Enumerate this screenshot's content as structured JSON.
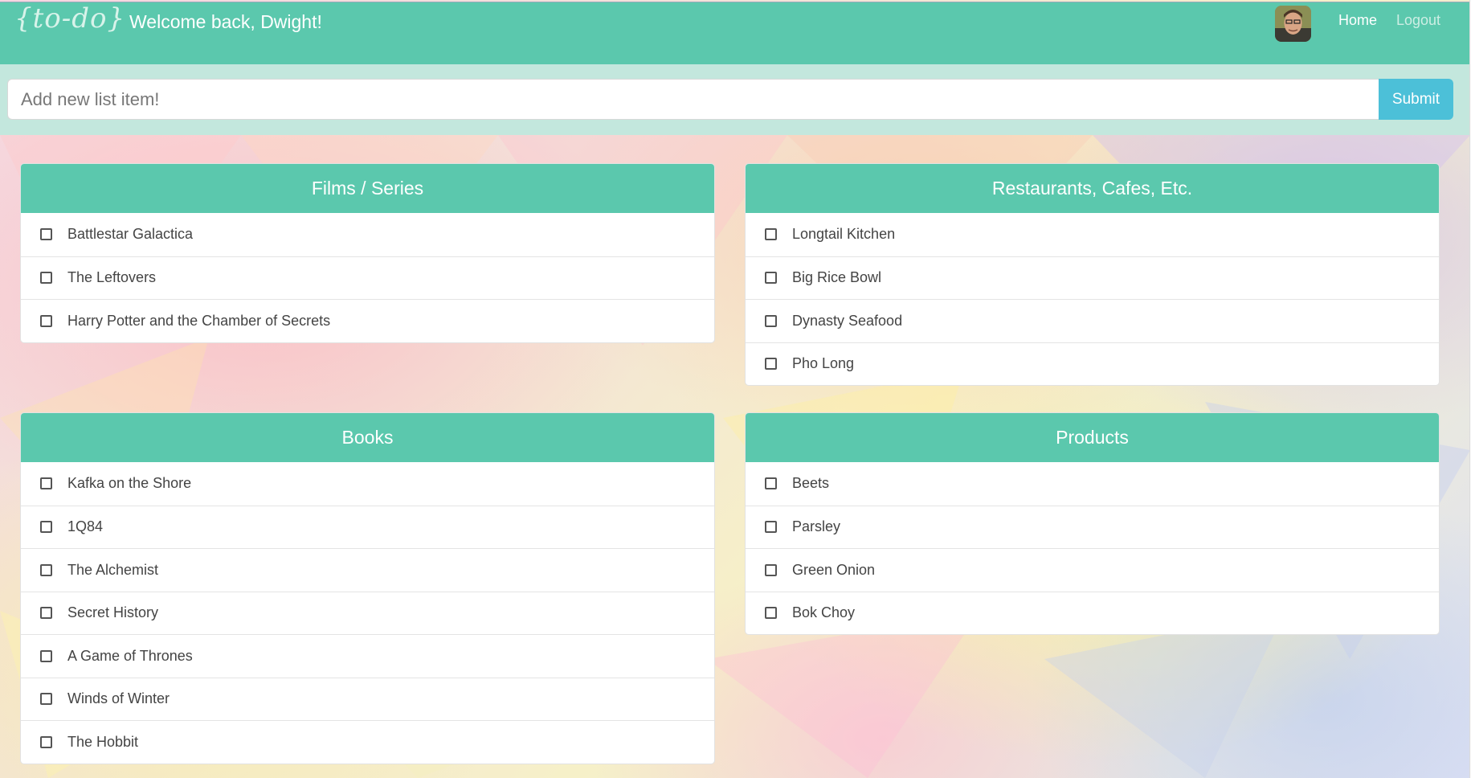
{
  "app": {
    "logo_text": "{to-do}",
    "welcome": "Welcome back, Dwight!",
    "nav": {
      "home": "Home",
      "logout": "Logout"
    },
    "colors": {
      "primary": "#5bc8ad",
      "submit": "#4cc0d8",
      "band": "#c3e7dd"
    }
  },
  "new_item": {
    "placeholder": "Add new list item!",
    "submit_label": "Submit"
  },
  "lists": [
    {
      "title": "Films / Series",
      "items": [
        "Battlestar Galactica",
        "The Leftovers",
        "Harry Potter and the Chamber of Secrets"
      ]
    },
    {
      "title": "Restaurants, Cafes, Etc.",
      "items": [
        "Longtail Kitchen",
        "Big Rice Bowl",
        "Dynasty Seafood",
        "Pho Long"
      ]
    },
    {
      "title": "Books",
      "items": [
        "Kafka on the Shore",
        "1Q84",
        "The Alchemist",
        "Secret History",
        "A Game of Thrones",
        "Winds of Winter",
        "The Hobbit"
      ]
    },
    {
      "title": "Products",
      "items": [
        "Beets",
        "Parsley",
        "Green Onion",
        "Bok Choy"
      ]
    }
  ]
}
